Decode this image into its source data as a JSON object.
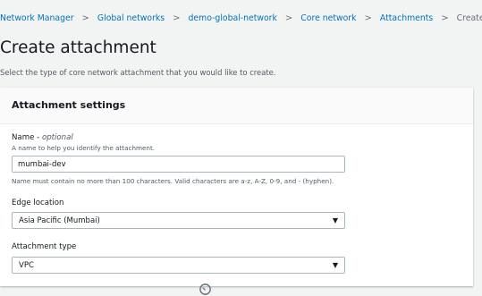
{
  "breadcrumb": {
    "items": [
      "Network Manager",
      "Global networks",
      "demo-global-network",
      "Core network",
      "Attachments"
    ],
    "current": "Create"
  },
  "page": {
    "title": "Create attachment",
    "description": "Select the type of core network attachment that you would like to create."
  },
  "panel": {
    "title": "Attachment settings",
    "name_field": {
      "label": "Name",
      "optional": "optional",
      "description": "A name to help you identify the attachment.",
      "value": "mumbai-dev",
      "constraint": "Name must contain no more than 100 characters. Valid characters are a-z, A-Z, 0-9, and - (hyphen)."
    },
    "edge_location": {
      "label": "Edge location",
      "selected": "Asia Pacific (Mumbai)"
    },
    "attachment_type": {
      "label": "Attachment type",
      "selected": "VPC"
    }
  },
  "colors": {
    "link": "#0073bb",
    "background": "#f2f3f3",
    "panel": "#ffffff",
    "border": "#aab7b8"
  },
  "icons": {
    "separator": "chevron-right-icon",
    "dropdown": "caret-down-icon",
    "loading": "spinner-icon"
  }
}
